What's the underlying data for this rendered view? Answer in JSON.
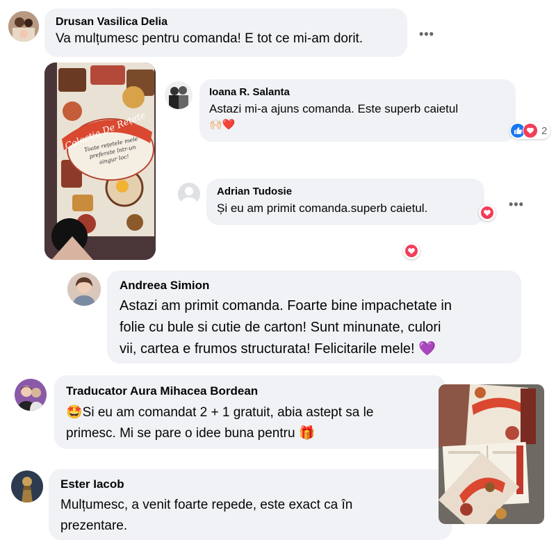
{
  "comments": [
    {
      "author": "Drusan Vasilica Delia",
      "text": "Va mulțumesc pentru comanda! E tot ce mi-am dorit.",
      "more": "•••"
    },
    {
      "author": "Ioana R. Salanta",
      "text": "Astazi mi-a ajuns comanda. Este superb caietul",
      "emoji": "🙌🏻❤️",
      "reaction_count": "2"
    },
    {
      "author": "Adrian Tudosie",
      "text": "Și eu am primit comanda.superb caietul.",
      "more": "•••"
    },
    {
      "author": "Andreea Simion",
      "lines": [
        "Astazi am primit comanda. Foarte bine impachetate in",
        "folie cu bule si cutie de carton! Sunt minunate, culori",
        "vii, cartea e frumos structurata! Felicitarile mele! 💜"
      ]
    },
    {
      "author": "Traducator Aura Mihacea Bordean",
      "lines": [
        "🤩Si eu am comandat 2 + 1 gratuit, abia astept sa le",
        "primesc. Mi se pare o idee buna pentru 🎁"
      ]
    },
    {
      "author": "Ester Iacob",
      "lines": [
        "Mulțumesc, a venit foarte repede, este exact ca în",
        "prezentare."
      ]
    }
  ],
  "book_photo": {
    "title": "Colecția De Rețete",
    "subtitle_lines": [
      "Toate rețetele mele",
      "preferate într-un",
      "singur loc!"
    ]
  },
  "colors": {
    "bubble": "#f0f2f5",
    "like_blue": "#1877f2",
    "love_red": "#f33e58",
    "purple_heart": "#8e44ec"
  }
}
